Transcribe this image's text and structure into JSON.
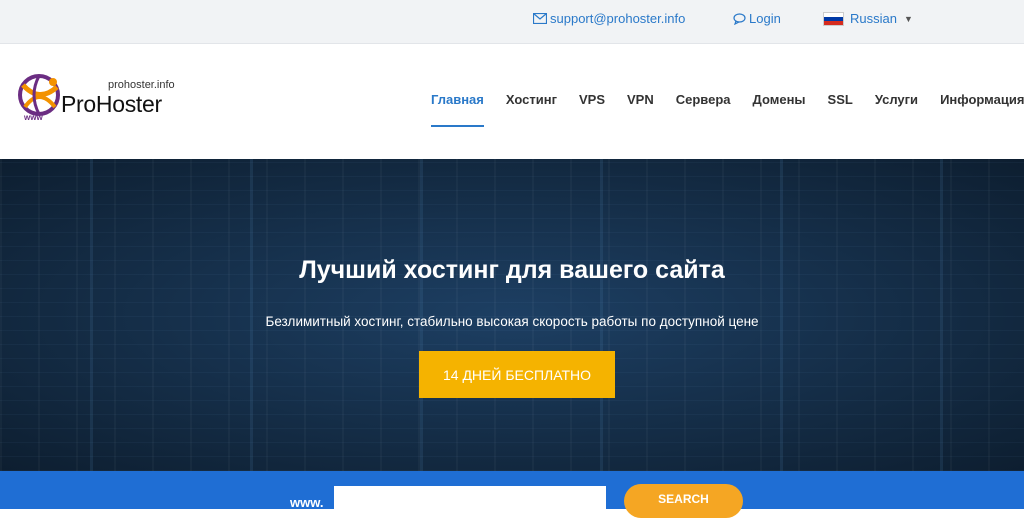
{
  "topbar": {
    "email": "support@prohoster.info",
    "login": "Login",
    "language": "Russian"
  },
  "logo": {
    "domain": "prohoster.info",
    "name": "ProHoster",
    "www": "www"
  },
  "nav": {
    "items": [
      {
        "label": "Главная",
        "active": true
      },
      {
        "label": "Хостинг"
      },
      {
        "label": "VPS"
      },
      {
        "label": "VPN"
      },
      {
        "label": "Сервера"
      },
      {
        "label": "Домены"
      },
      {
        "label": "SSL"
      },
      {
        "label": "Услуги"
      },
      {
        "label": "Информация"
      }
    ]
  },
  "hero": {
    "title": "Лучший хостинг для вашего сайта",
    "subtitle": "Безлимитный хостинг, стабильно высокая скорость работы по доступной цене",
    "cta": "14 ДНЕЙ БЕСПЛАТНО"
  },
  "domain_search": {
    "prefix": "www.",
    "input_value": "",
    "button": "SEARCH"
  },
  "colors": {
    "accent_blue": "#2a79c9",
    "cta_yellow": "#f5b300",
    "search_orange": "#f5a623",
    "domain_bar": "#1f6ed4"
  }
}
